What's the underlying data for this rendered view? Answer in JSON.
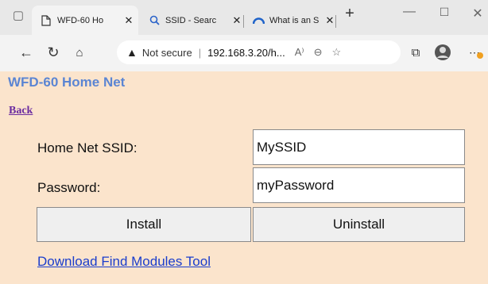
{
  "browser": {
    "tabs": [
      {
        "title": "WFD-60 Ho",
        "icon": "page-icon",
        "active": true
      },
      {
        "title": "SSID - Searc",
        "icon": "search-icon",
        "active": false
      },
      {
        "title": "What is an S",
        "icon": "edge-icon",
        "active": false
      }
    ],
    "new_tab_label": "+",
    "address": {
      "security": "Not secure",
      "url": "192.168.3.20/h...",
      "reader_icon": "A⁾"
    }
  },
  "page": {
    "title": "WFD-60 Home Net",
    "back_link": "Back",
    "ssid_label": "Home Net SSID:",
    "ssid_value": "MySSID",
    "password_label": "Password:",
    "password_value": "myPassword",
    "install_label": "Install",
    "uninstall_label": "Uninstall",
    "download_link": "Download Find Modules Tool"
  },
  "colors": {
    "page_bg": "#fbe4cc",
    "title": "#5b85d3",
    "link": "#1a3dcc",
    "visited": "#6b2ca0"
  }
}
